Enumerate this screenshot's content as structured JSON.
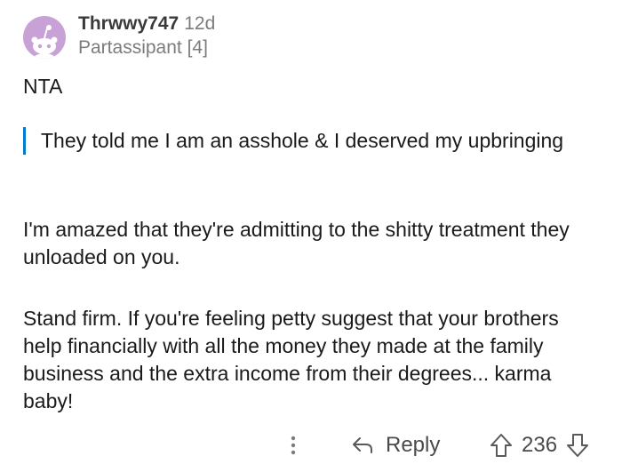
{
  "comment": {
    "username": "Thrwwy747",
    "age": "12d",
    "flair": "Partassipant [4]",
    "avatar_icon": "reddit-snoo-avatar-icon",
    "paragraphs": {
      "nta": "NTA",
      "quote": "They told me I am an asshole & I deserved my upbringing",
      "p1": "I'm amazed that they're admitting to the shitty treatment they unloaded on you.",
      "p2": "Stand firm. If you're feeling petty suggest that your brothers help financially with all the money they made at the family business and the extra income from their degrees... karma baby!"
    },
    "actions": {
      "more_icon": "more-options-icon",
      "reply_icon": "reply-arrow-icon",
      "reply_label": "Reply",
      "upvote_icon": "upvote-arrow-icon",
      "vote_count": "236",
      "downvote_icon": "downvote-arrow-icon"
    }
  },
  "colors": {
    "quote_bar": "#0079d3",
    "avatar_bg": "#c8a2d6",
    "meta_text": "#7c7c7c",
    "body_text": "#1a1a1b"
  }
}
